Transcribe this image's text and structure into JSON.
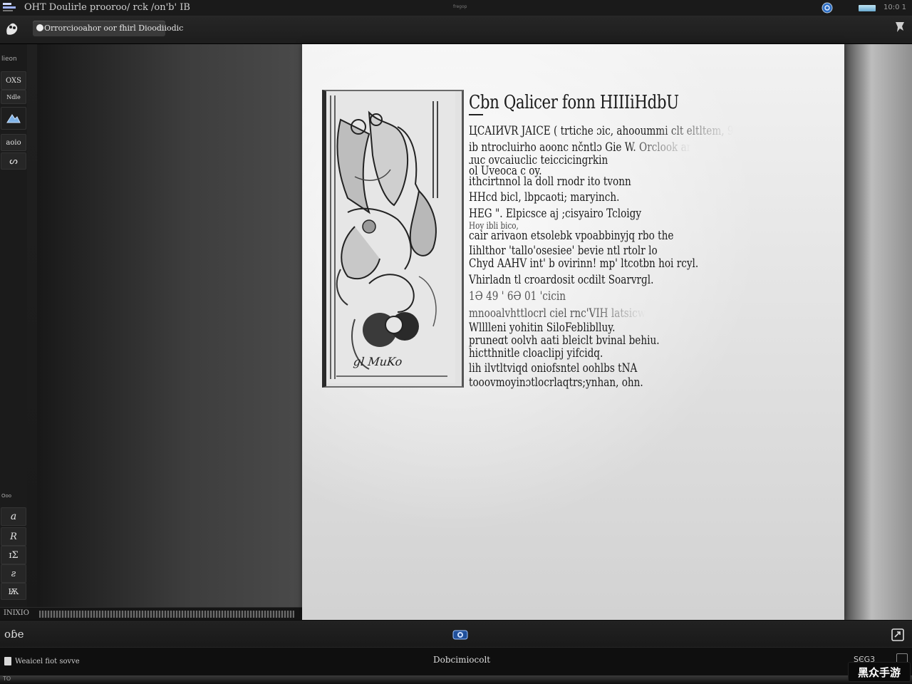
{
  "window": {
    "title": "ОНТ Doulirle prooroo/ rck /on'b' IB",
    "center_label": "fregop",
    "clock": "10:0 1"
  },
  "toolbar": {
    "doc_tab_label": "Orrorciooahor oor fhirl Dioodiiodic"
  },
  "sidebar": {
    "top_label": "lieon",
    "buttons": [
      "OXS",
      "Ndle",
      "",
      "aoio",
      "ᔕ"
    ],
    "bottom_label": "Ooo",
    "bottom_buttons": [
      "a",
      "R",
      "ɪΣ",
      "ꙅ",
      "Ѭ"
    ]
  },
  "ruler": {
    "label": "INIXIO"
  },
  "document": {
    "title": "Cbn Qalicer fonn HIIIiHdbU",
    "art_caption": "gl MuKo",
    "lines": [
      {
        "text": "ЦCAIИVR JAICE ( trtiche ɔic, ahooummi clt eltltem, 9",
        "cls": "fade-tail"
      },
      {
        "text": "ib ntrocluirho aoonc nčntlɔ Gie W. Orclook ar",
        "cls": "fade-tail"
      },
      {
        "text": "ɹuc ovcaiuclic teiccicingrkin",
        "cls": ""
      },
      {
        "text": "ol Uveoca c oy.",
        "cls": ""
      },
      {
        "text": "ithcirtnnol la doll rnodr ito tvonn",
        "cls": ""
      },
      {
        "text": "HHcd bicl, lbpcaoti; maryinch.",
        "cls": ""
      },
      {
        "text": "HEG \". Elpicsce aj ;cisyairo Tcloigy",
        "cls": ""
      },
      {
        "text": "Hoy ibli bico,",
        "cls": "small"
      },
      {
        "text": "cair arivaon etsolebk vpoabbinyjq rbo the",
        "cls": ""
      },
      {
        "text": "Iihlthor 'tallo'osesiee' bevie ntl rtolr lo",
        "cls": ""
      },
      {
        "text": "Chyd AAHV int' b ovirinn! mp' ltcotbn hoi rcyl.",
        "cls": ""
      },
      {
        "text": "Vhirladn tl croardosit ocdilt Soarvrɡl.",
        "cls": ""
      },
      {
        "text": "1Ə 49 ' 6Ə 01 'cicin",
        "cls": "faint"
      },
      {
        "text": "mnooalvhttlocrl ciel rnc'VIH latsicw",
        "cls": "faint fade-tail"
      },
      {
        "text": "Wlllleni yohitin SiloFebliblluy.",
        "cls": ""
      },
      {
        "text": "pruneɑt oolvh aati bleiclt bvinal behiu.",
        "cls": ""
      },
      {
        "text": "hictthnitle cloaclipj yifcidq.",
        "cls": ""
      },
      {
        "text": "lih ilvtltviqd oniofsntel oohlbs tNA",
        "cls": ""
      },
      {
        "text": "tooovmoyinɔtlocrlaqtrs;ynhan, ohn.",
        "cls": ""
      }
    ]
  },
  "statusbar": {
    "left_label": "oɓe"
  },
  "taskbar": {
    "task_label": "Weaicel fiot sovve",
    "center_text": "Dobcimiocolt",
    "tray_text": "SЄG3"
  },
  "bottom_edge": {
    "label": "TO"
  },
  "watermark": {
    "text": "黑众手游"
  }
}
